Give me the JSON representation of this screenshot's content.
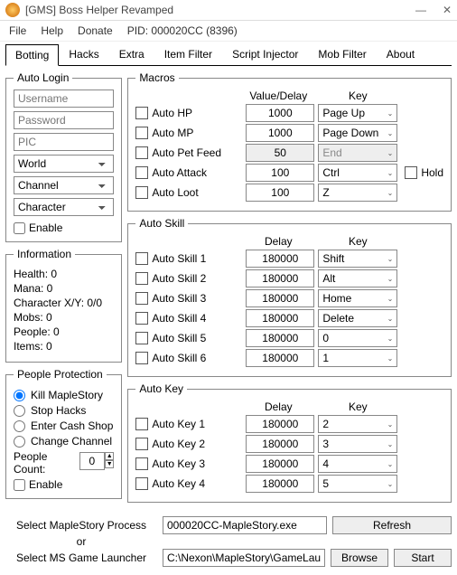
{
  "titlebar": {
    "title": "[GMS] Boss Helper Revamped"
  },
  "menubar": {
    "file": "File",
    "help": "Help",
    "donate": "Donate",
    "pid": "PID: 000020CC (8396)"
  },
  "tabs": [
    "Botting",
    "Hacks",
    "Extra",
    "Item Filter",
    "Script Injector",
    "Mob Filter",
    "About"
  ],
  "autologin": {
    "legend": "Auto Login",
    "username_ph": "Username",
    "password_ph": "Password",
    "pic_ph": "PIC",
    "world": "World",
    "channel": "Channel",
    "character": "Character",
    "enable": "Enable"
  },
  "information": {
    "legend": "Information",
    "health": "Health: 0",
    "mana": "Mana: 0",
    "xy": "Character X/Y: 0/0",
    "mobs": "Mobs: 0",
    "people": "People: 0",
    "items": "Items: 0"
  },
  "protection": {
    "legend": "People Protection",
    "kill": "Kill MapleStory",
    "stop": "Stop Hacks",
    "cash": "Enter Cash Shop",
    "change": "Change Channel",
    "count_label": "People Count:",
    "count": "0",
    "enable": "Enable"
  },
  "macros": {
    "legend": "Macros",
    "head_val": "Value/Delay",
    "head_key": "Key",
    "rows": [
      {
        "label": "Auto HP",
        "val": "1000",
        "key": "Page Up"
      },
      {
        "label": "Auto MP",
        "val": "1000",
        "key": "Page Down"
      },
      {
        "label": "Auto Pet Feed",
        "val": "50",
        "key": "End",
        "grey": true
      },
      {
        "label": "Auto Attack",
        "val": "100",
        "key": "Ctrl",
        "hold": true
      },
      {
        "label": "Auto Loot",
        "val": "100",
        "key": "Z"
      }
    ],
    "hold": "Hold"
  },
  "autoskill": {
    "legend": "Auto Skill",
    "head_val": "Delay",
    "head_key": "Key",
    "rows": [
      {
        "label": "Auto Skill 1",
        "val": "180000",
        "key": "Shift"
      },
      {
        "label": "Auto Skill 2",
        "val": "180000",
        "key": "Alt"
      },
      {
        "label": "Auto Skill 3",
        "val": "180000",
        "key": "Home"
      },
      {
        "label": "Auto Skill 4",
        "val": "180000",
        "key": "Delete"
      },
      {
        "label": "Auto Skill 5",
        "val": "180000",
        "key": "0"
      },
      {
        "label": "Auto Skill 6",
        "val": "180000",
        "key": "1"
      }
    ]
  },
  "autokey": {
    "legend": "Auto Key",
    "head_val": "Delay",
    "head_key": "Key",
    "rows": [
      {
        "label": "Auto Key 1",
        "val": "180000",
        "key": "2"
      },
      {
        "label": "Auto Key 2",
        "val": "180000",
        "key": "3"
      },
      {
        "label": "Auto Key 3",
        "val": "180000",
        "key": "4"
      },
      {
        "label": "Auto Key 4",
        "val": "180000",
        "key": "5"
      }
    ]
  },
  "footer": {
    "select_process": "Select MapleStory Process",
    "or": "or",
    "select_launcher": "Select MS Game Launcher",
    "process": "000020CC-MapleStory.exe",
    "launcher": "C:\\Nexon\\MapleStory\\GameLauncher.exe",
    "refresh": "Refresh",
    "browse": "Browse",
    "start": "Start"
  }
}
